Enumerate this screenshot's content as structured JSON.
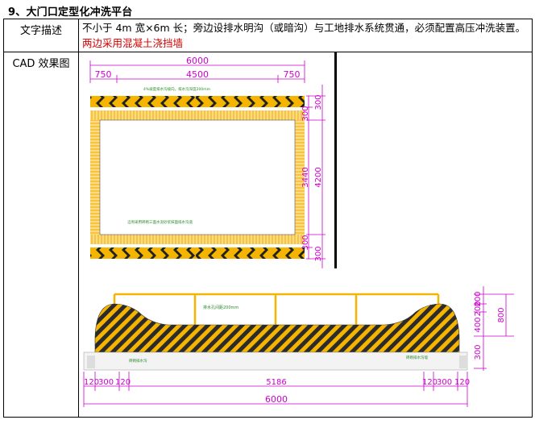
{
  "heading": "9、大门口定型化冲洗平台",
  "rows": [
    {
      "label": "文字描述",
      "text": "不小于 4m 宽×6m 长；旁边设排水明沟（或暗沟）与工地排水系统贯通，必须配置高压冲洗装置。",
      "highlight": "两边采用混凝土浇挡墙"
    },
    {
      "label": "CAD 效果图"
    }
  ],
  "plan": {
    "total_width": "6000",
    "left": "750",
    "middle": "4500",
    "right": "750",
    "dim_300_top_outer": "300",
    "dim_300_top_inner": "300",
    "dim_3440": "3440",
    "dim_4200": "4200",
    "dim_300_bottom_inner": "300",
    "dim_300_bottom_outer": "300",
    "note_top": "4%坡度排水沟坡向，排水沟深度200mm",
    "note_bottom": "沿周采用砖砌三面水泥砂浆抹面排水沟道"
  },
  "section": {
    "note_pipe": "排水孔间距200mm",
    "note_left": "砖砌排水沟",
    "note_right": "砖砌排水沟墙",
    "dims_right": [
      "200",
      "200",
      "400",
      "300"
    ],
    "dim_total_height": "800",
    "dims_bottom": [
      "120",
      "300",
      "120",
      "5186",
      "120",
      "300",
      "120"
    ],
    "total_length": "6000"
  },
  "colors": {
    "dimension": "#cc00cc",
    "hazard_yellow": "#f5b400",
    "hazard_black": "#222222"
  }
}
